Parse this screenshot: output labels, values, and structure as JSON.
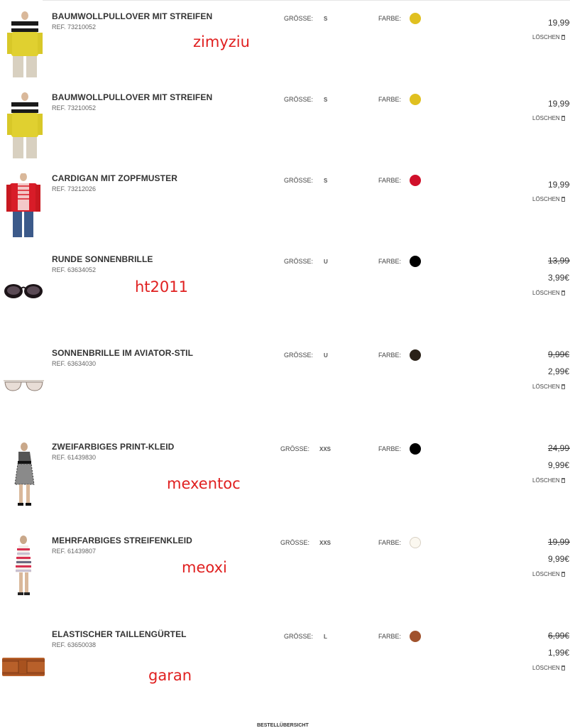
{
  "labels": {
    "size": "GRÖSSE:",
    "color": "FARBE:",
    "delete": "LÖSCHEN"
  },
  "items": [
    {
      "name": "BAUMWOLLPULLOVER MIT STREIFEN",
      "ref": "REF. 73210052",
      "size": "S",
      "color": "#e0c020",
      "price": "19,99€"
    },
    {
      "name": "BAUMWOLLPULLOVER MIT STREIFEN",
      "ref": "REF. 73210052",
      "size": "S",
      "color": "#e0c020",
      "price": "19,99€"
    },
    {
      "name": "CARDIGAN MIT ZOPFMUSTER",
      "ref": "REF. 73212026",
      "size": "S",
      "color": "#d0102a",
      "price": "19,99€"
    },
    {
      "name": "RUNDE SONNENBRILLE",
      "ref": "REF. 63634052",
      "size": "U",
      "color": "#000000",
      "old_price": "13,99€",
      "price": "3,99€"
    },
    {
      "name": "SONNENBRILLE IM AVIATOR-STIL",
      "ref": "REF. 63634030",
      "size": "U",
      "color": "#2a2118",
      "old_price": "9,99€",
      "price": "2,99€"
    },
    {
      "name": "ZWEIFARBIGES PRINT-KLEID",
      "ref": "REF. 61439830",
      "size": "XXS",
      "color": "#000000",
      "old_price": "24,99€",
      "price": "9,99€"
    },
    {
      "name": "MEHRFARBIGES STREIFENKLEID",
      "ref": "REF. 61439807",
      "size": "XXS",
      "color": "#fbf8f0",
      "old_price": "19,99€",
      "price": "9,99€"
    },
    {
      "name": "ELASTISCHER TAILLENGÜRTEL",
      "ref": "REF. 63650038",
      "size": "L",
      "color": "#a0522d",
      "old_price": "6,99€",
      "price": "1,99€"
    }
  ],
  "watermarks": [
    "zimyziu",
    "ht2011",
    "mexentoc",
    "meoxi",
    "garan"
  ],
  "footer_link": "BESTELLÜBERSICHT"
}
